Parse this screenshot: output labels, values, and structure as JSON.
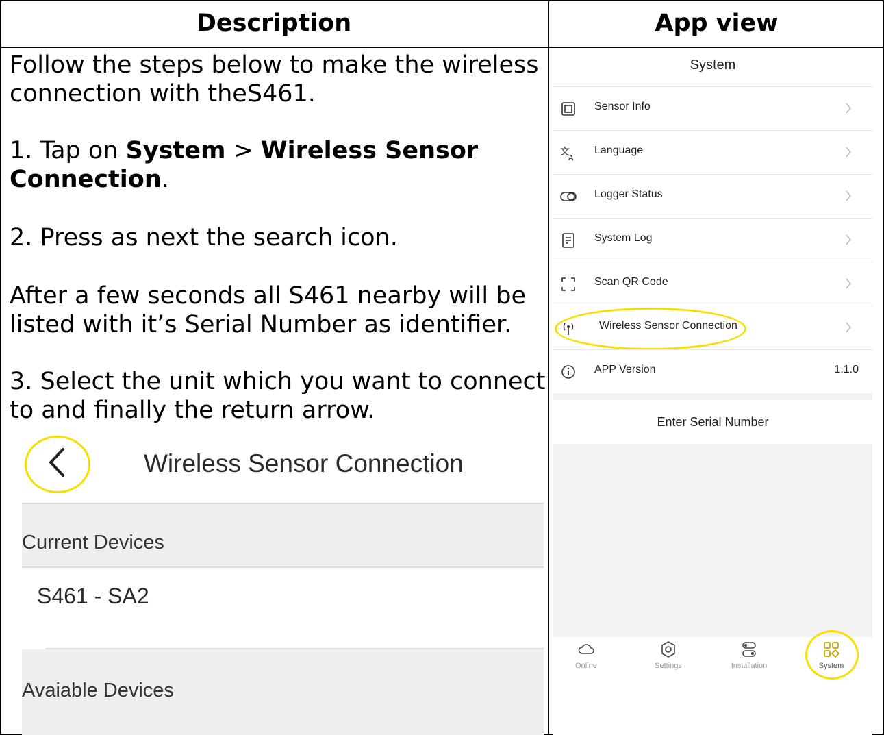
{
  "table": {
    "header_description": "Description",
    "header_app_view": "App view"
  },
  "description": {
    "intro_line1": "Follow the steps below to make the wireless",
    "intro_line2": "connection with theS461.",
    "step1_prefix": "1. Tap on ",
    "step1_system": "System",
    "step1_sep": " > ",
    "step1_wsc_part1": "Wireless Sensor",
    "step1_wsc_part2": "Connection",
    "step1_end": ".",
    "step2": "2. Press as next the search icon.",
    "after_line1": "After a few seconds all S461 nearby will be",
    "after_line2": "listed with it’s Serial Number as identifier.",
    "step3_line1": "3. Select the unit which you want to connect",
    "step3_line2": "to and finally the return arrow."
  },
  "left_screen": {
    "title": "Wireless Sensor Connection",
    "current_devices_label": "Current Devices",
    "device": "S461 - SA2",
    "available_devices_label": "Avaiable Devices",
    "highlight_color": "#f5e000"
  },
  "app": {
    "title": "System",
    "menu": [
      {
        "label": "Sensor Info",
        "icon": "chip-icon"
      },
      {
        "label": "Language",
        "icon": "translate-icon"
      },
      {
        "label": "Logger Status",
        "icon": "toggle-icon"
      },
      {
        "label": "System Log",
        "icon": "document-icon"
      },
      {
        "label": "Scan QR Code",
        "icon": "scan-icon"
      },
      {
        "label": "Wireless Sensor Connection",
        "icon": "antenna-icon"
      },
      {
        "label": "APP Version",
        "icon": "info-icon",
        "value": "1.1.0"
      }
    ],
    "serial_label": "Enter Serial Number",
    "tabs": [
      {
        "label": "Online",
        "icon": "cloud-icon"
      },
      {
        "label": "Settings",
        "icon": "gear-icon"
      },
      {
        "label": "Installation",
        "icon": "installation-icon"
      },
      {
        "label": "System",
        "icon": "grid-icon"
      }
    ]
  }
}
